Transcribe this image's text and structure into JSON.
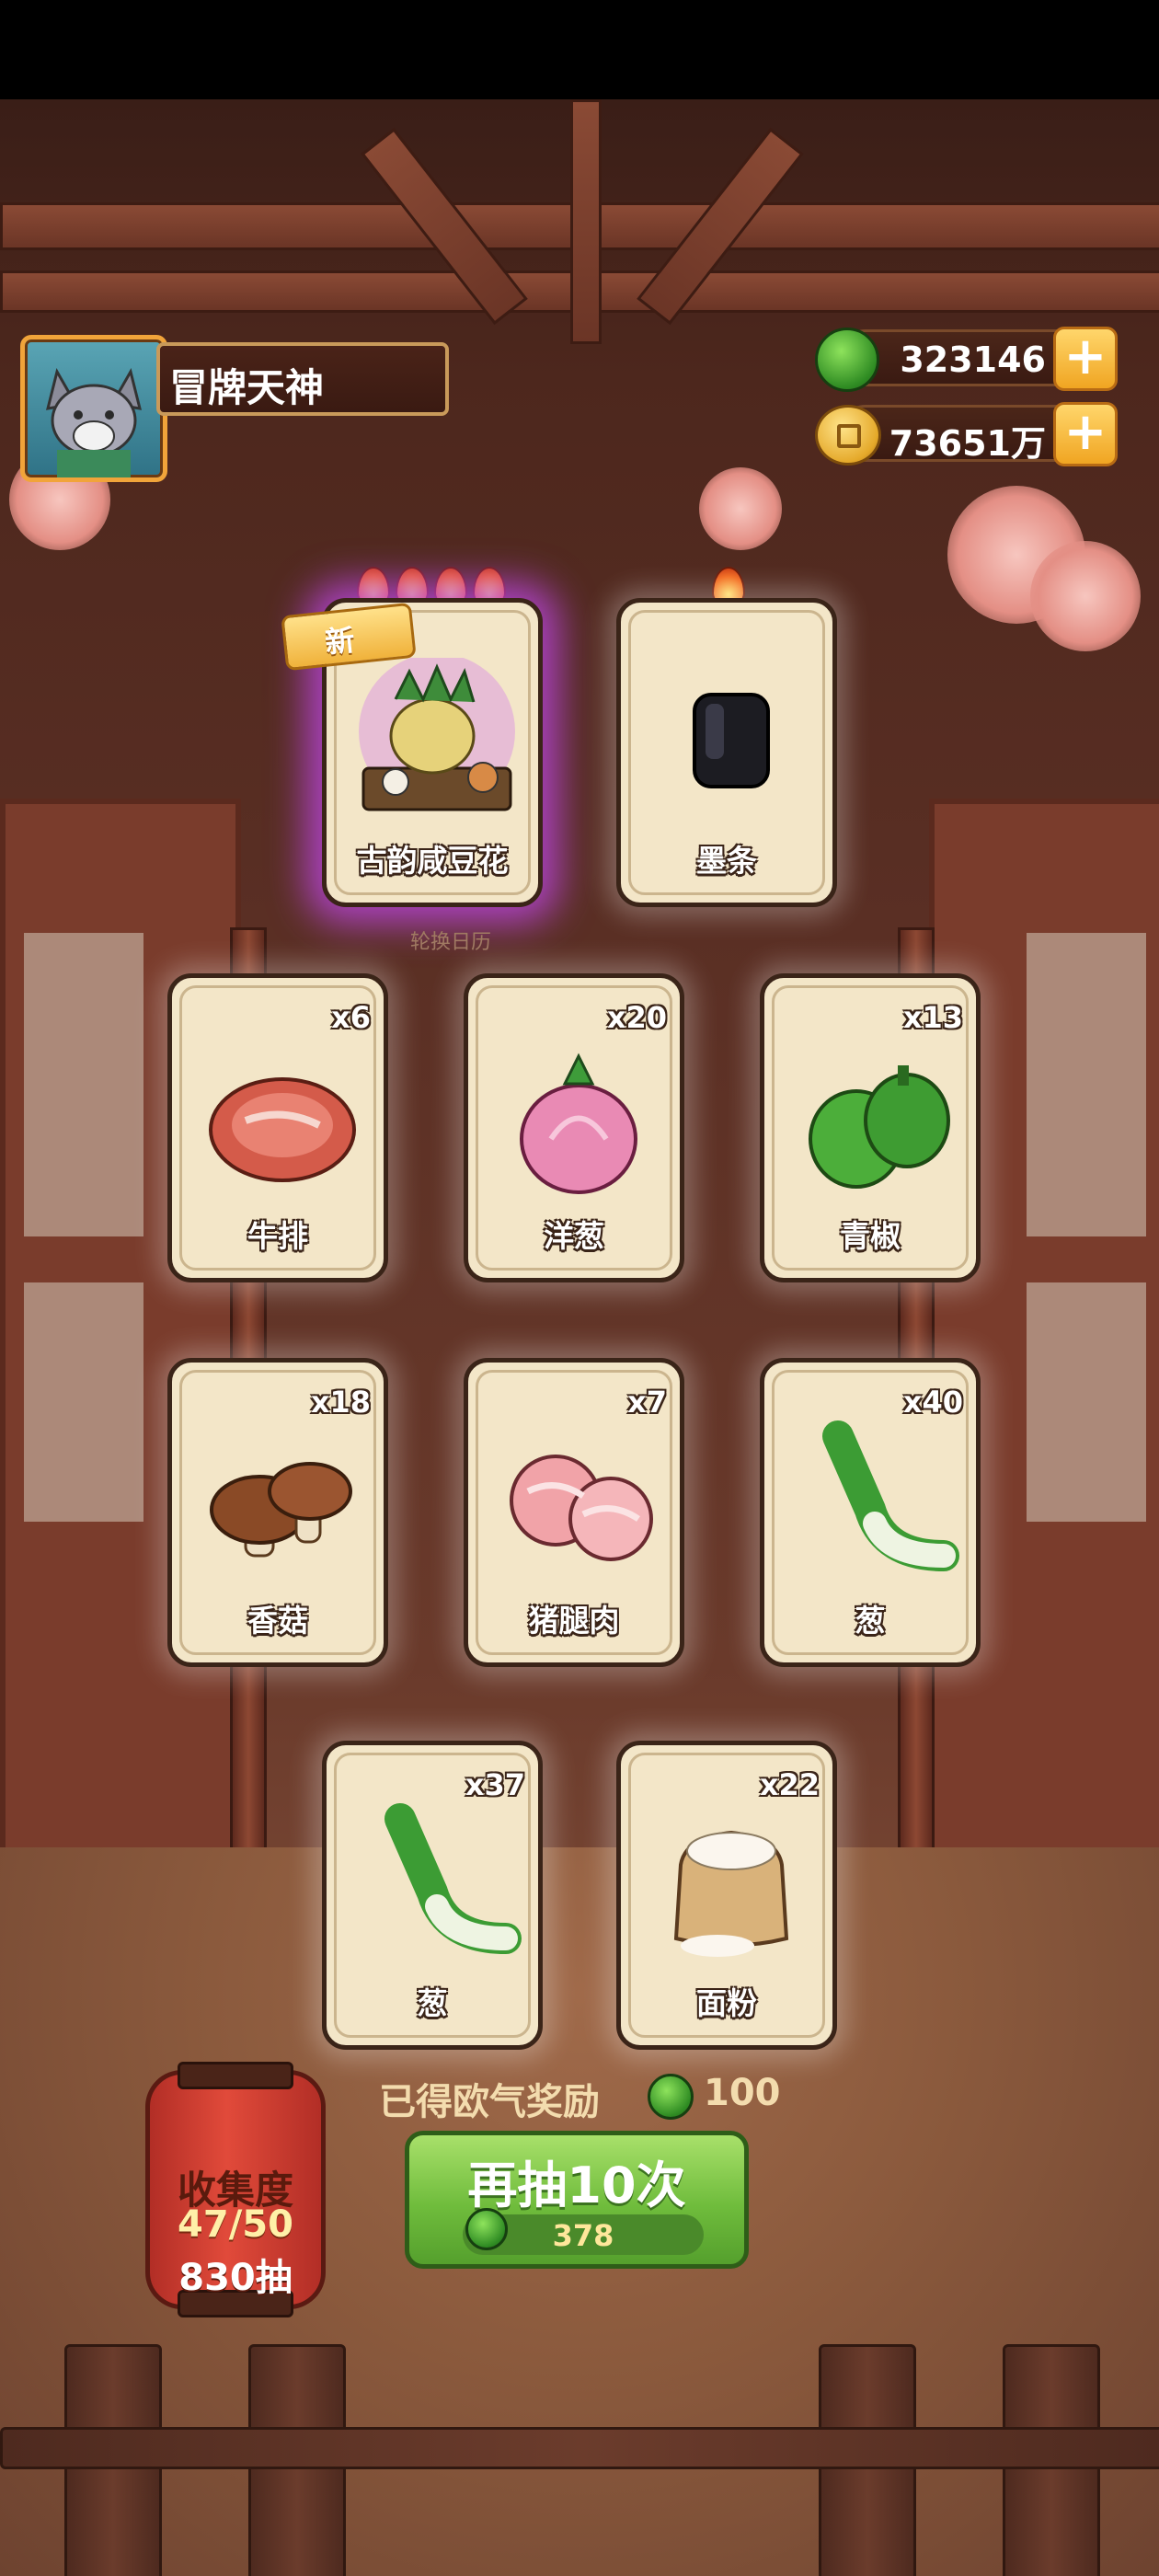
{
  "player": {
    "name": "冒牌天神"
  },
  "currency": {
    "gems": "323146",
    "coins": "73651万"
  },
  "banner": {
    "rotate_label": "轮换日历"
  },
  "cards": [
    {
      "name": "古韵咸豆花",
      "qty": "",
      "rarity_flames": 4,
      "is_new": true,
      "new_label": "新"
    },
    {
      "name": "墨条",
      "qty": "",
      "rarity_flames": 1,
      "is_new": false
    },
    {
      "name": "牛排",
      "qty": "x6"
    },
    {
      "name": "洋葱",
      "qty": "x20"
    },
    {
      "name": "青椒",
      "qty": "x13"
    },
    {
      "name": "香菇",
      "qty": "x18"
    },
    {
      "name": "猪腿肉",
      "qty": "x7"
    },
    {
      "name": "葱",
      "qty": "x40"
    },
    {
      "name": "葱",
      "qty": "x37"
    },
    {
      "name": "面粉",
      "qty": "x22"
    }
  ],
  "luck": {
    "label": "已得欧气奖励",
    "value": "100"
  },
  "draw_button": {
    "label": "再抽10次",
    "cost": "378"
  },
  "collection": {
    "title": "收集度",
    "progress": "47/50",
    "draws": "830抽"
  },
  "colors": {
    "accent_green": "#6fbc3c",
    "gold": "#f0a522",
    "rare_glow": "#be46e6"
  }
}
